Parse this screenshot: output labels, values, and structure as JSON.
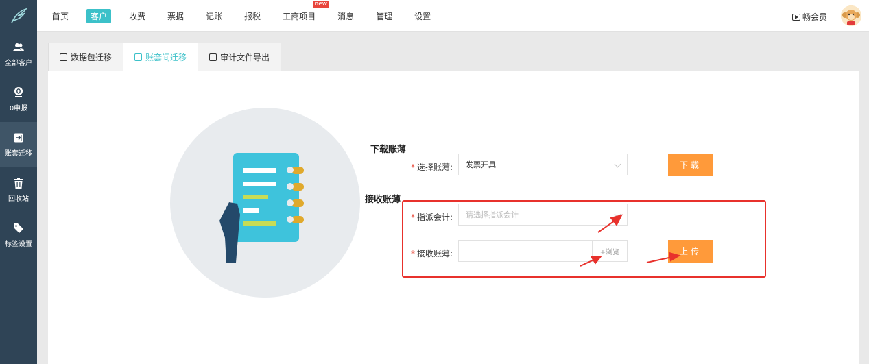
{
  "nav": {
    "items": [
      {
        "label": "首页"
      },
      {
        "label": "客户"
      },
      {
        "label": "收费"
      },
      {
        "label": "票据"
      },
      {
        "label": "记账"
      },
      {
        "label": "报税"
      },
      {
        "label": "工商项目",
        "badge": "new"
      },
      {
        "label": "消息"
      },
      {
        "label": "管理"
      },
      {
        "label": "设置"
      }
    ],
    "active_index": 1,
    "vip_label": "畅会员"
  },
  "sidebar": {
    "items": [
      {
        "label": "全部客户",
        "icon": "users-icon"
      },
      {
        "label": "0申报",
        "icon": "zero-declare-icon"
      },
      {
        "label": "账套迁移",
        "icon": "migrate-icon"
      },
      {
        "label": "回收站",
        "icon": "trash-icon"
      },
      {
        "label": "标签设置",
        "icon": "tag-icon"
      }
    ],
    "active_index": 2
  },
  "tabs": [
    {
      "label": "数据包迁移"
    },
    {
      "label": "账套间迁移"
    },
    {
      "label": "审计文件导出"
    }
  ],
  "download": {
    "title": "下载账薄",
    "select_label": "选择账薄:",
    "select_value": "发票开具",
    "button": "下载"
  },
  "receive": {
    "title": "接收账薄",
    "accountant_label": "指派会计:",
    "accountant_placeholder": "请选择指派会计",
    "book_label": "接收账薄:",
    "browse": "+浏览",
    "button": "上传"
  },
  "colors": {
    "sidebar_bg": "#2f4456",
    "accent": "#3cc1c9",
    "button": "#ff9a3a",
    "highlight": "#e8312c"
  }
}
